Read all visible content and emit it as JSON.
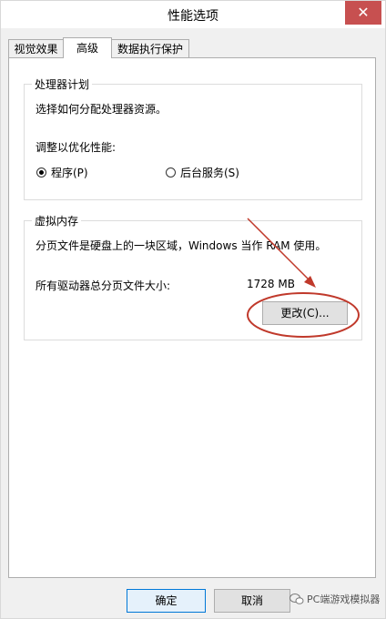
{
  "window": {
    "title": "性能选项",
    "close_glyph": "✕"
  },
  "tabs": [
    {
      "label": "视觉效果",
      "active": false
    },
    {
      "label": "高级",
      "active": true
    },
    {
      "label": "数据执行保护",
      "active": false
    }
  ],
  "processor": {
    "title": "处理器计划",
    "description": "选择如何分配处理器资源。",
    "adjust_label": "调整以优化性能:",
    "options": [
      {
        "label": "程序(P)",
        "checked": true
      },
      {
        "label": "后台服务(S)",
        "checked": false
      }
    ]
  },
  "virtual_memory": {
    "title": "虚拟内存",
    "description": "分页文件是硬盘上的一块区域，Windows 当作 RAM 使用。",
    "total_label": "所有驱动器总分页文件大小:",
    "total_value": "1728 MB",
    "change_button": "更改(C)..."
  },
  "footer": {
    "ok_button": "确定",
    "cancel_button": "取消"
  },
  "watermark": {
    "text": "PC端游戏模拟器"
  },
  "annotation": {
    "color": "#c0392b",
    "icon": "red-arrow-and-circle"
  }
}
